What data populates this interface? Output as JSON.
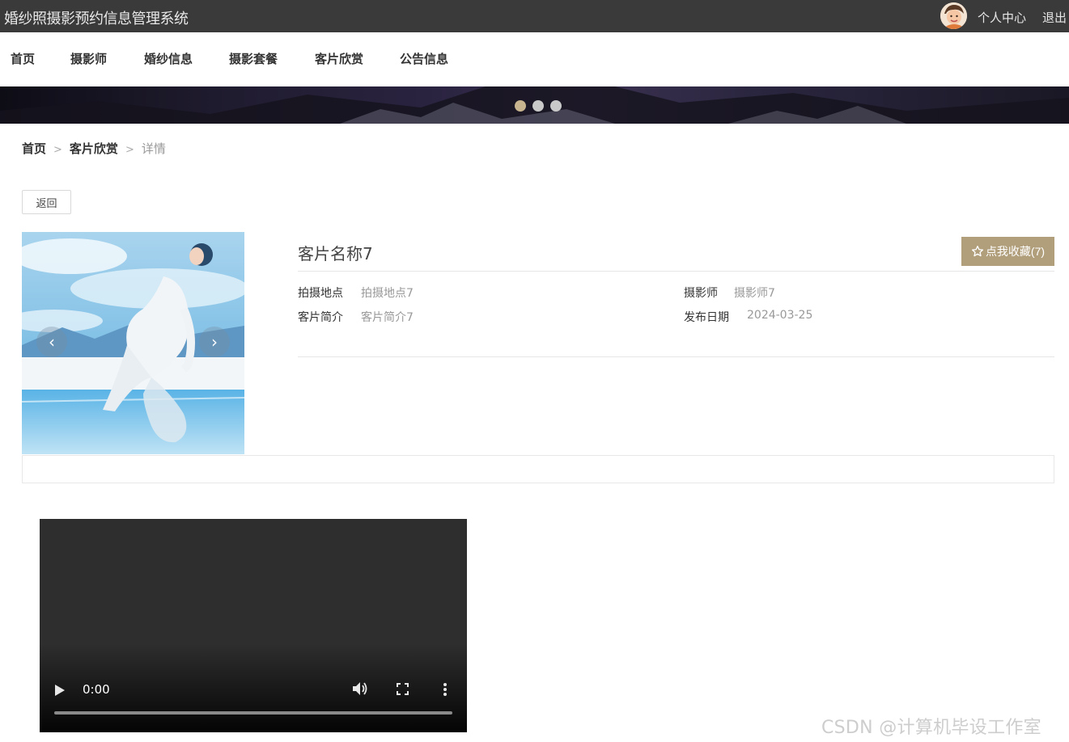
{
  "header": {
    "site_title": "婚纱照摄影预约信息管理系统",
    "user_center": "个人中心",
    "logout": "退出"
  },
  "nav": {
    "items": [
      {
        "label": "首页"
      },
      {
        "label": "摄影师"
      },
      {
        "label": "婚纱信息"
      },
      {
        "label": "摄影套餐"
      },
      {
        "label": "客片欣赏"
      },
      {
        "label": "公告信息"
      }
    ]
  },
  "banner": {
    "dots": 3,
    "active_dot": 0,
    "colors": {
      "active": "#c8b48e",
      "inactive": "#c9c9c9"
    }
  },
  "breadcrumb": {
    "home": "首页",
    "section": "客片欣赏",
    "current": "详情",
    "separator": ">"
  },
  "back_button": "返回",
  "detail": {
    "title": "客片名称7",
    "favorite_label": "点我收藏(7)",
    "fields": {
      "location_label": "拍摄地点",
      "location_value": "拍摄地点7",
      "photographer_label": "摄影师",
      "photographer_value": "摄影师7",
      "intro_label": "客片简介",
      "intro_value": "客片简介7",
      "date_label": "发布日期",
      "date_value": "2024-03-25"
    }
  },
  "video": {
    "time": "0:00"
  },
  "watermark": "CSDN @计算机毕设工作室",
  "colors": {
    "topbar": "#3a3a3a",
    "accent": "#b19f7c"
  },
  "icons": {
    "favorite": "star-outline-icon",
    "prev": "chevron-left-icon",
    "next": "chevron-right-icon",
    "play": "play-icon",
    "volume": "volume-icon",
    "fullscreen": "fullscreen-icon",
    "more": "more-vertical-icon"
  }
}
